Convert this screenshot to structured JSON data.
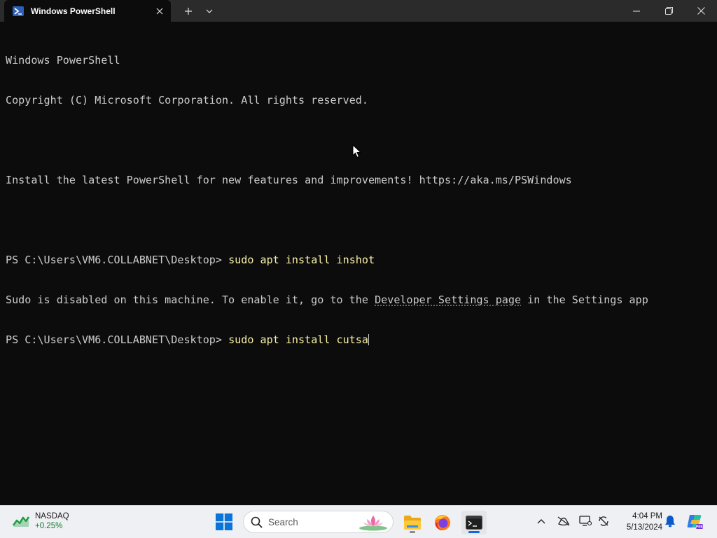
{
  "window": {
    "tab_title": "Windows PowerShell",
    "icons": [
      "powershell-icon",
      "close-icon",
      "plus-icon",
      "chevron-down-icon",
      "minimize-icon",
      "restore-icon",
      "close-icon"
    ]
  },
  "terminal": {
    "lines": [
      "Windows PowerShell",
      "Copyright (C) Microsoft Corporation. All rights reserved.",
      "",
      "Install the latest PowerShell for new features and improvements! https://aka.ms/PSWindows",
      ""
    ],
    "prompt": "PS C:\\Users\\VM6.COLLABNET\\Desktop>",
    "command1": "sudo apt install inshot",
    "error_prefix": "Sudo is disabled on this machine. To enable it, go to the ",
    "error_link": "Developer Settings page",
    "error_suffix": " in the Settings app",
    "command2": "sudo apt install cutsa",
    "colors": {
      "background": "#0c0c0c",
      "text": "#cccccc",
      "command": "#f9f1a5"
    }
  },
  "taskbar": {
    "widget_name": "NASDAQ",
    "widget_change": "+0.25%",
    "search_label": "Search",
    "apps": [
      "file-explorer-icon",
      "firefox-icon",
      "terminal-icon"
    ],
    "time": "4:04 PM",
    "date": "5/13/2024"
  }
}
